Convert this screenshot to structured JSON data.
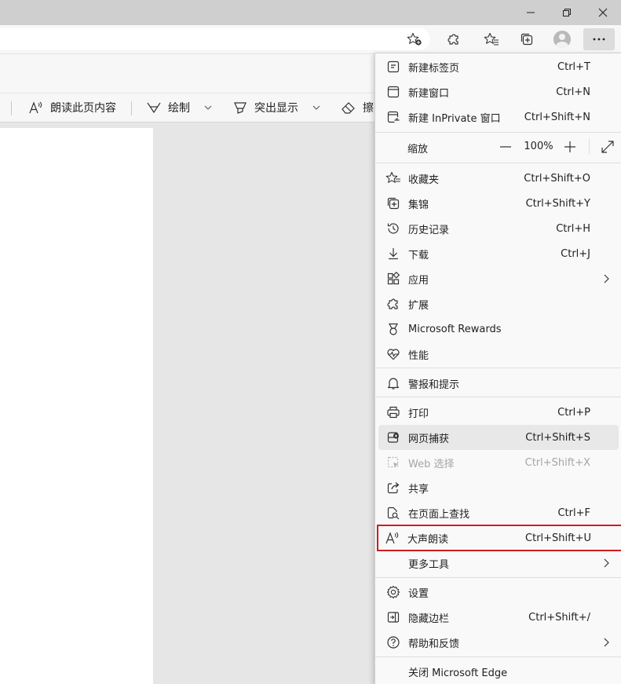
{
  "colors": {
    "highlight_border": "#d11c1c",
    "menu_bg": "#f9f9f9",
    "hover_bg": "#e8e8e8",
    "disabled_text": "#a5a5a5"
  },
  "pdf_toolbar": {
    "read_aloud": "朗读此页内容",
    "draw": "绘制",
    "highlight": "突出显示",
    "erase": "擦"
  },
  "menu": {
    "new_tab": {
      "label": "新建标签页",
      "shortcut": "Ctrl+T",
      "icon": "new-tab-icon"
    },
    "new_window": {
      "label": "新建窗口",
      "shortcut": "Ctrl+N",
      "icon": "new-window-icon"
    },
    "new_inprivate": {
      "label": "新建 InPrivate 窗口",
      "shortcut": "Ctrl+Shift+N",
      "icon": "inprivate-icon"
    },
    "zoom": {
      "label": "缩放",
      "minus": "—",
      "value": "100%",
      "plus": "+"
    },
    "favorites": {
      "label": "收藏夹",
      "shortcut": "Ctrl+Shift+O",
      "icon": "favorites-icon"
    },
    "collections": {
      "label": "集锦",
      "shortcut": "Ctrl+Shift+Y",
      "icon": "collections-icon"
    },
    "history": {
      "label": "历史记录",
      "shortcut": "Ctrl+H",
      "icon": "history-icon"
    },
    "downloads": {
      "label": "下载",
      "shortcut": "Ctrl+J",
      "icon": "download-icon"
    },
    "apps": {
      "label": "应用",
      "icon": "apps-icon"
    },
    "extensions": {
      "label": "扩展",
      "icon": "extensions-icon"
    },
    "rewards": {
      "label": "Microsoft Rewards",
      "icon": "rewards-icon"
    },
    "performance": {
      "label": "性能",
      "icon": "performance-icon"
    },
    "alerts": {
      "label": "警报和提示",
      "icon": "bell-icon"
    },
    "print": {
      "label": "打印",
      "shortcut": "Ctrl+P",
      "icon": "print-icon"
    },
    "capture": {
      "label": "网页捕获",
      "shortcut": "Ctrl+Shift+S",
      "icon": "web-capture-icon"
    },
    "web_select": {
      "label": "Web 选择",
      "shortcut": "Ctrl+Shift+X",
      "icon": "web-select-icon"
    },
    "share": {
      "label": "共享",
      "icon": "share-icon"
    },
    "find": {
      "label": "在页面上查找",
      "shortcut": "Ctrl+F",
      "icon": "find-icon"
    },
    "read_aloud": {
      "label": "大声朗读",
      "shortcut": "Ctrl+Shift+U",
      "icon": "read-aloud-icon"
    },
    "more_tools": {
      "label": "更多工具"
    },
    "settings": {
      "label": "设置",
      "icon": "gear-icon"
    },
    "hide_sidebar": {
      "label": "隐藏边栏",
      "shortcut": "Ctrl+Shift+/",
      "icon": "sidebar-icon"
    },
    "help": {
      "label": "帮助和反馈",
      "icon": "help-icon"
    },
    "close_edge": {
      "label": "关闭 Microsoft Edge"
    }
  }
}
